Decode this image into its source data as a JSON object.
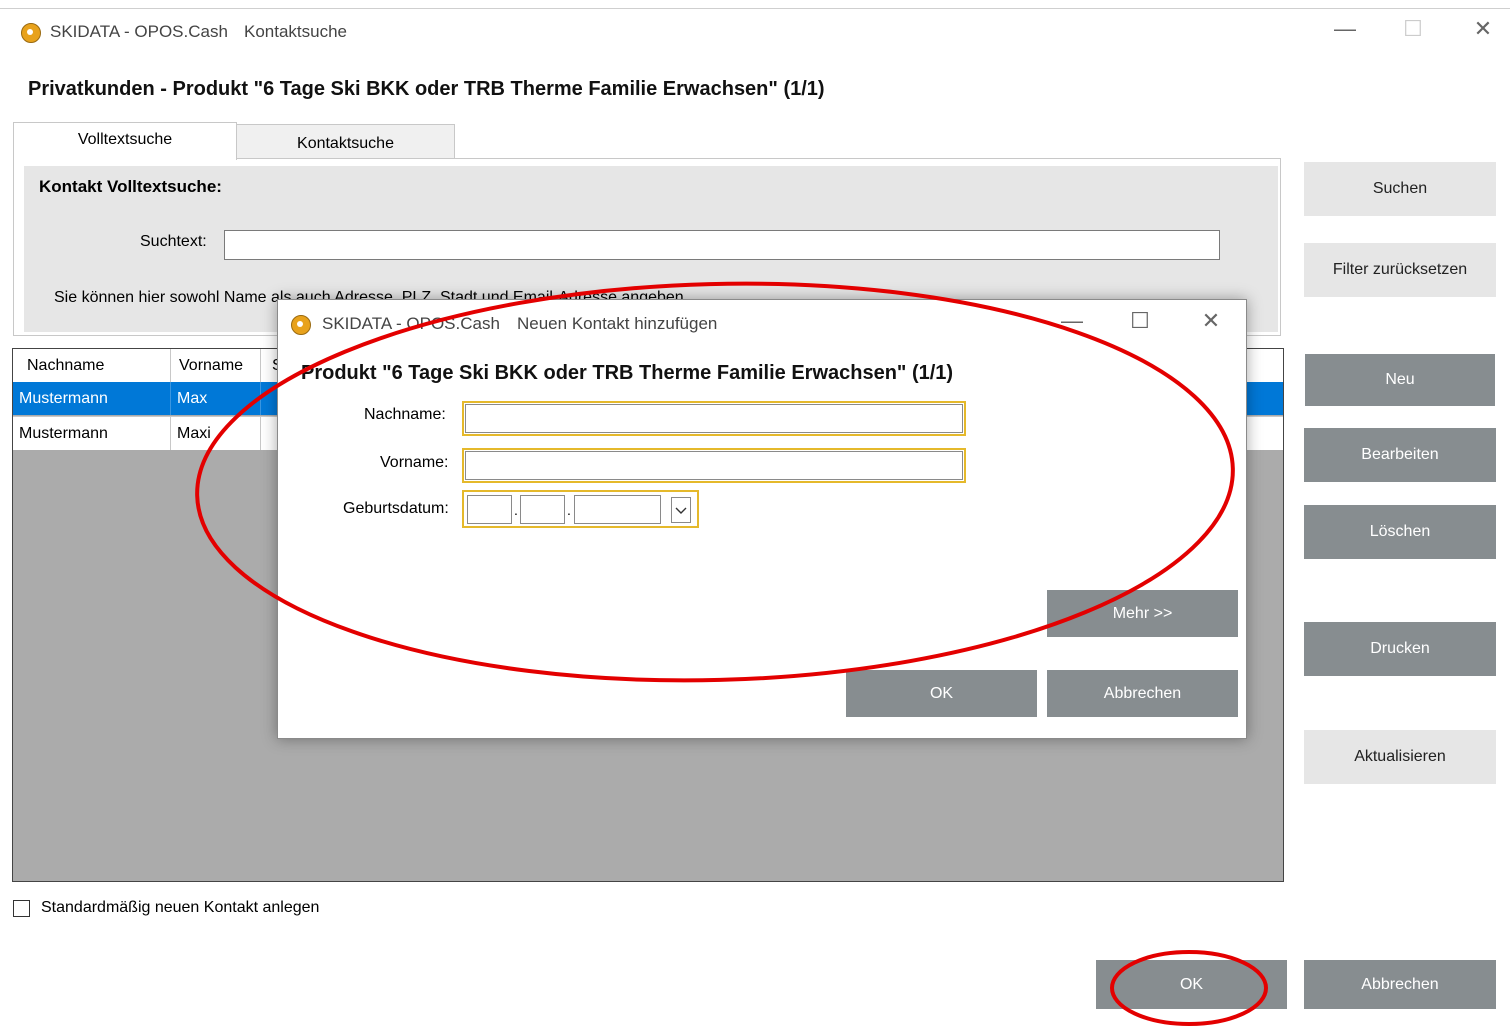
{
  "main_window": {
    "app_name": "SKIDATA - OPOS.Cash",
    "window_title": "Kontaktsuche",
    "minimize_glyph": "—",
    "maximize_glyph": "☐",
    "close_glyph": "✕"
  },
  "heading": "Privatkunden - Produkt \"6 Tage Ski BKK oder TRB Therme Familie Erwachsen\" (1/1)",
  "tabs": [
    {
      "label": "Volltextsuche",
      "active": true
    },
    {
      "label": "Kontaktsuche",
      "active": false
    }
  ],
  "search_panel": {
    "title": "Kontakt Volltextsuche:",
    "suchtext_label": "Suchtext:",
    "suchtext_value": "",
    "hint": "Sie können hier sowohl Name als auch Adresse, PLZ, Stadt und Email-Adresse angeben."
  },
  "grid": {
    "columns": [
      "Nachname",
      "Vorname",
      "S"
    ],
    "rows": [
      {
        "nachname": "Mustermann",
        "vorname": "Max",
        "selected": true
      },
      {
        "nachname": "Mustermann",
        "vorname": "Maxi",
        "selected": false
      }
    ]
  },
  "side_buttons": {
    "suchen": "Suchen",
    "filter": "Filter zurücksetzen",
    "neu": "Neu",
    "bearbeiten": "Bearbeiten",
    "loeschen": "Löschen",
    "drucken": "Drucken",
    "aktualisieren": "Aktualisieren"
  },
  "checkbox": {
    "label": "Standardmäßig neuen Kontakt anlegen",
    "checked": false
  },
  "footer_buttons": {
    "ok": "OK",
    "abbrechen": "Abbrechen"
  },
  "dialog": {
    "app_name": "SKIDATA - OPOS.Cash",
    "window_title": "Neuen Kontakt hinzufügen",
    "heading": "Produkt \"6 Tage Ski BKK oder TRB Therme Familie Erwachsen\" (1/1)",
    "nachname_label": "Nachname:",
    "nachname_value": "",
    "vorname_label": "Vorname:",
    "vorname_value": "",
    "geburtsdatum_label": "Geburtsdatum:",
    "date_separator": ".",
    "mehr": "Mehr >>",
    "ok": "OK",
    "abbrechen": "Abbrechen"
  },
  "colors": {
    "selection": "#0078d7",
    "annotation": "#e30000",
    "required_border": "#e5b92b",
    "dark_button": "#878d90"
  },
  "icons": {
    "app": "skidata-app-icon",
    "dropdown": "chevron-down-icon"
  }
}
